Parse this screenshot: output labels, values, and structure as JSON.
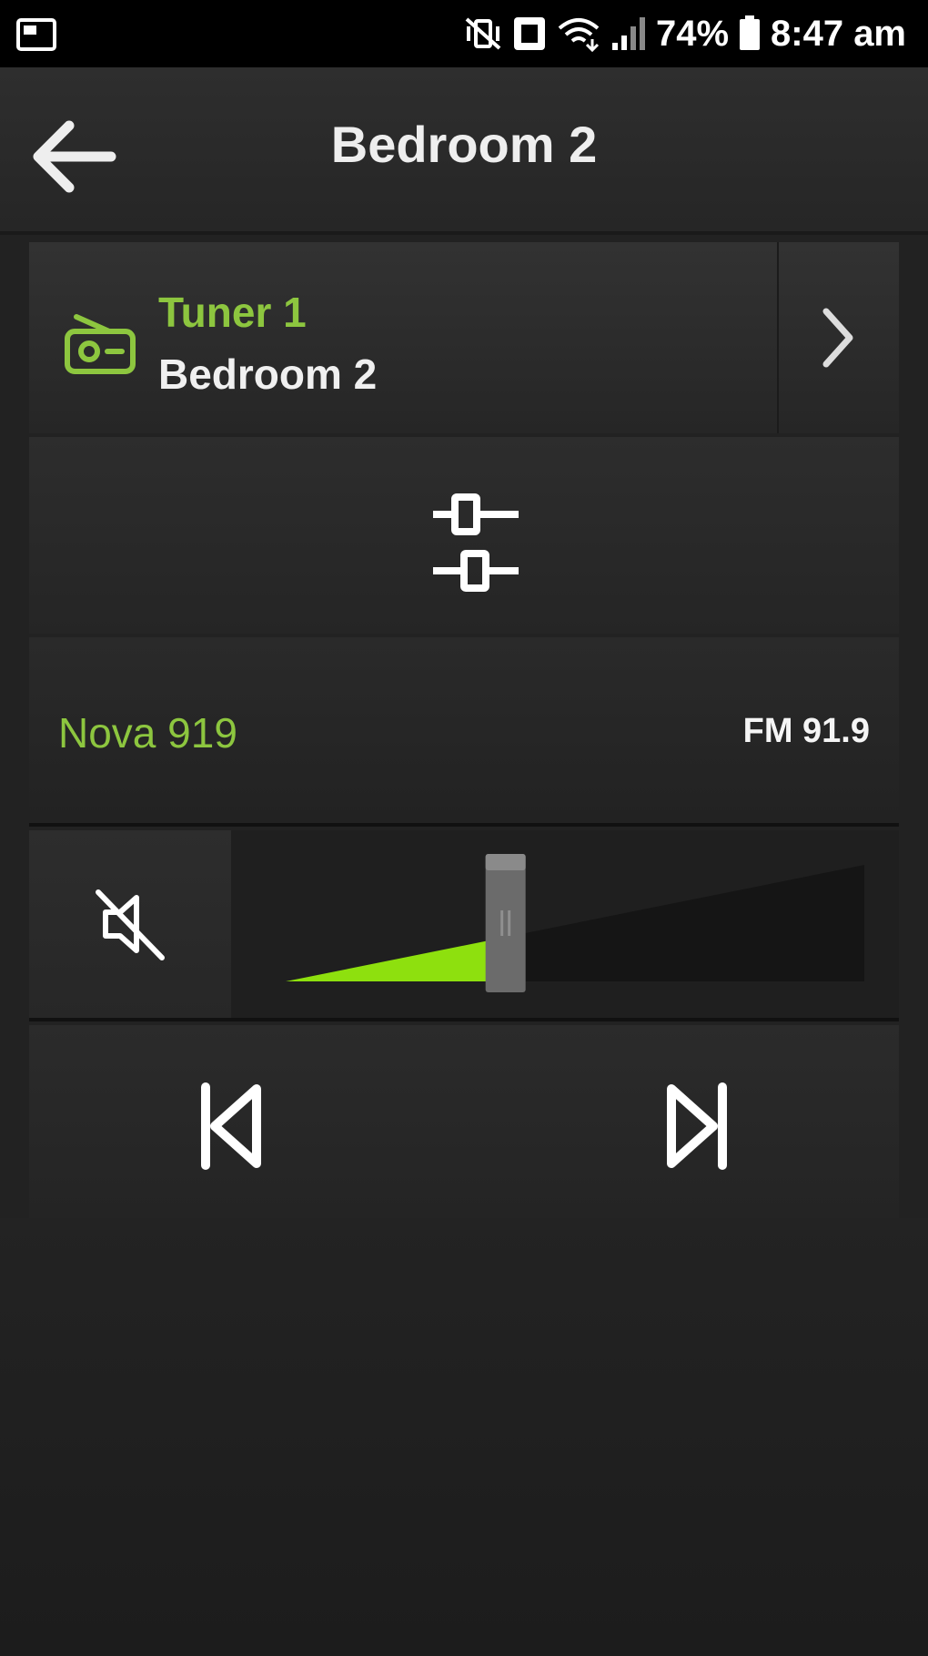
{
  "status_bar": {
    "battery": "74%",
    "time": "8:47 am",
    "icons": [
      "screenshot-icon",
      "mute-vibrate-icon",
      "nfc-icon",
      "wifi-icon",
      "signal-icon",
      "battery-icon"
    ]
  },
  "header": {
    "title": "Bedroom 2",
    "back_icon": "arrow-left-icon"
  },
  "source": {
    "name": "Tuner 1",
    "zone": "Bedroom 2",
    "icon": "radio-icon",
    "chevron_icon": "chevron-right-icon"
  },
  "equalizer": {
    "icon": "sliders-icon"
  },
  "station": {
    "name": "Nova 919",
    "frequency": "FM 91.9"
  },
  "volume": {
    "mute_icon": "speaker-muted-icon",
    "level": 0.38
  },
  "transport": {
    "prev_icon": "skip-previous-icon",
    "next_icon": "skip-next-icon"
  },
  "colors": {
    "accent": "#8dc63f",
    "background": "#222222",
    "text": "#ffffff"
  }
}
